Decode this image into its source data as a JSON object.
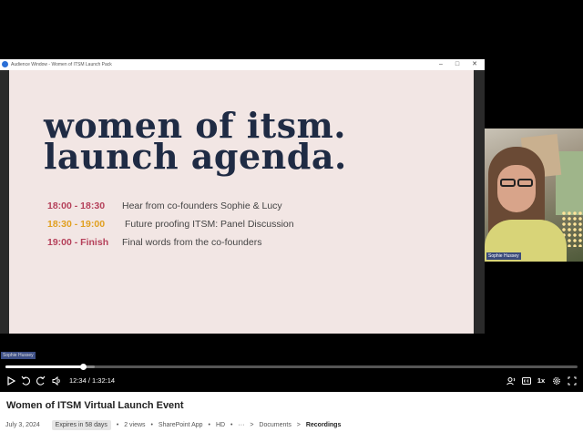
{
  "window": {
    "title": "Audience Window - Women of ITSM Launch Pack"
  },
  "slide": {
    "heading_line1": "women of itsm.",
    "heading_line2": "launch agenda.",
    "agenda": [
      {
        "time": "18:00 - 18:30",
        "description": "Hear from co-founders Sophie & Lucy",
        "color": "#b5405a"
      },
      {
        "time": "18:30 - 19:00",
        "description": "Future proofing ITSM: Panel Discussion",
        "color": "#e0a020"
      },
      {
        "time": "19:00 - Finish",
        "description": "Final words from the co-founders",
        "color": "#b5405a"
      }
    ]
  },
  "participant": {
    "name": "Sophie Hussey"
  },
  "speaker_tooltip": "Sophie Hussey",
  "player": {
    "current_time": "12:34",
    "duration": "1:32:14",
    "progress_fraction": 0.136,
    "buffered_fraction": 0.156,
    "speed": "1x",
    "icons": [
      "play-icon",
      "rewind-icon",
      "forward-icon",
      "volume-icon",
      "speaker-coach-icon",
      "captions-icon",
      "settings-icon",
      "fullscreen-icon"
    ]
  },
  "video": {
    "title": "Women of ITSM Virtual Launch Event",
    "date": "July 3, 2024",
    "expires": "Expires in 58 days",
    "views": "2 views",
    "app": "SharePoint App",
    "quality": "HD",
    "more": "···",
    "breadcrumb": [
      "Documents",
      "Recordings"
    ]
  }
}
